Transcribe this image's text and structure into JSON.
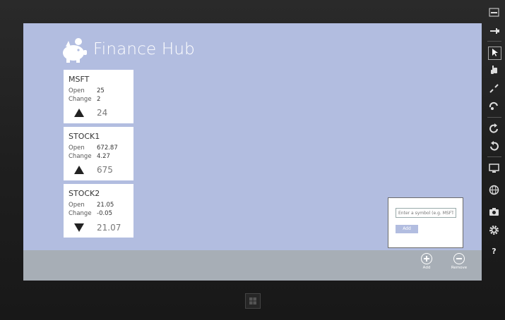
{
  "app": {
    "title": "Finance Hub"
  },
  "stocks": [
    {
      "symbol": "MSFT",
      "open_label": "Open",
      "open": "25",
      "change_label": "Change",
      "change": "2",
      "direction": "up",
      "price": "24"
    },
    {
      "symbol": "STOCK1",
      "open_label": "Open",
      "open": "672.87",
      "change_label": "Change",
      "change": "4.27",
      "direction": "up",
      "price": "675"
    },
    {
      "symbol": "STOCK2",
      "open_label": "Open",
      "open": "21.05",
      "change_label": "Change",
      "change": "-0.05",
      "direction": "down",
      "price": "21.07"
    }
  ],
  "flyout": {
    "placeholder": "Enter a symbol (e.g. MSFT)",
    "add_label": "Add"
  },
  "appbar": {
    "add_label": "Add",
    "remove_label": "Remove"
  },
  "simulator_rail": {
    "icons": [
      "minimize-icon",
      "pin-icon",
      "mouse-mode-icon",
      "touch-mode-icon",
      "pinch-zoom-icon",
      "rotate-touch-icon",
      "rotate-clockwise-icon",
      "rotate-counterclockwise-icon",
      "resolution-icon",
      "location-icon",
      "screenshot-icon",
      "settings-icon",
      "help-icon"
    ],
    "help_label": "?"
  },
  "colors": {
    "screen_bg": "#b2bde0",
    "appbar_bg": "#a7aeb6",
    "tile_bg": "#ffffff"
  }
}
